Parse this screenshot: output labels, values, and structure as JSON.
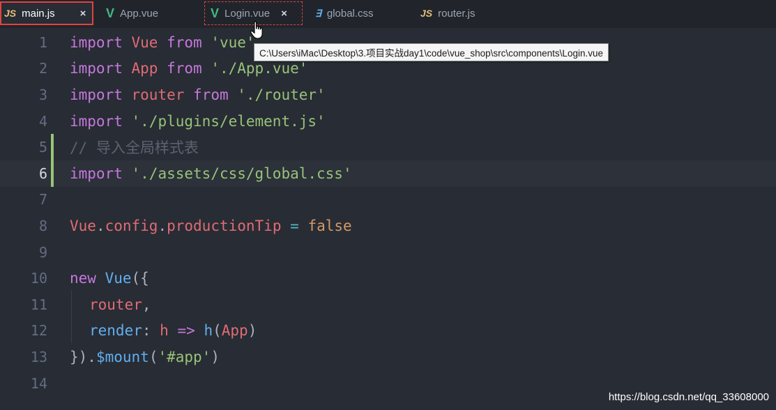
{
  "tabs": [
    {
      "icon": "JS",
      "icon_kind": "js",
      "label": "main.js",
      "close": "×",
      "active": true
    },
    {
      "icon": "V",
      "icon_kind": "vue",
      "label": "App.vue"
    },
    {
      "icon": "V",
      "icon_kind": "vue",
      "label": "Login.vue",
      "close": "×"
    },
    {
      "icon": "∃",
      "icon_kind": "css",
      "label": "global.css"
    },
    {
      "icon": "JS",
      "icon_kind": "js",
      "label": "router.js"
    }
  ],
  "tooltip": "C:\\Users\\iMac\\Desktop\\3.项目实战day1\\code\\vue_shop\\src\\components\\Login.vue",
  "line_numbers": [
    "1",
    "2",
    "3",
    "4",
    "5",
    "6",
    "7",
    "8",
    "9",
    "10",
    "11",
    "12",
    "13",
    "14"
  ],
  "code": {
    "l1": {
      "kw": "import",
      "name": "Vue",
      "from": "from",
      "str": "'vue'"
    },
    "l2": {
      "kw": "import",
      "name": "App",
      "from": "from",
      "str": "'./App.vue'"
    },
    "l3": {
      "kw": "import",
      "name": "router",
      "from": "from",
      "str": "'./router'"
    },
    "l4": {
      "kw": "import",
      "str": "'./plugins/element.js'"
    },
    "l5": {
      "comment": "// 导入全局样式表"
    },
    "l6": {
      "kw": "import",
      "str": "'./assets/css/global.css'"
    },
    "l8": {
      "obj": "Vue",
      "dot1": ".",
      "prop1": "config",
      "dot2": ".",
      "prop2": "productionTip",
      "eq": "=",
      "val": "false"
    },
    "l10": {
      "kw": "new",
      "cls": "Vue",
      "open": "({"
    },
    "l11": {
      "prop": "router",
      "comma": ","
    },
    "l12": {
      "fn": "render",
      "colon": ":",
      "param": "h",
      "arrow": "=>",
      "call": "h",
      "paren_open": "(",
      "arg": "App",
      "paren_close": ")"
    },
    "l13": {
      "close": "})",
      "dot": ".",
      "method": "$mount",
      "paren_open": "(",
      "str": "'#app'",
      "paren_close": ")"
    }
  },
  "watermark": "https://blog.csdn.net/qq_33608000",
  "colors": {
    "background": "#282c34",
    "tab_highlight": "#e0443e",
    "modified_bar": "#98c379"
  }
}
